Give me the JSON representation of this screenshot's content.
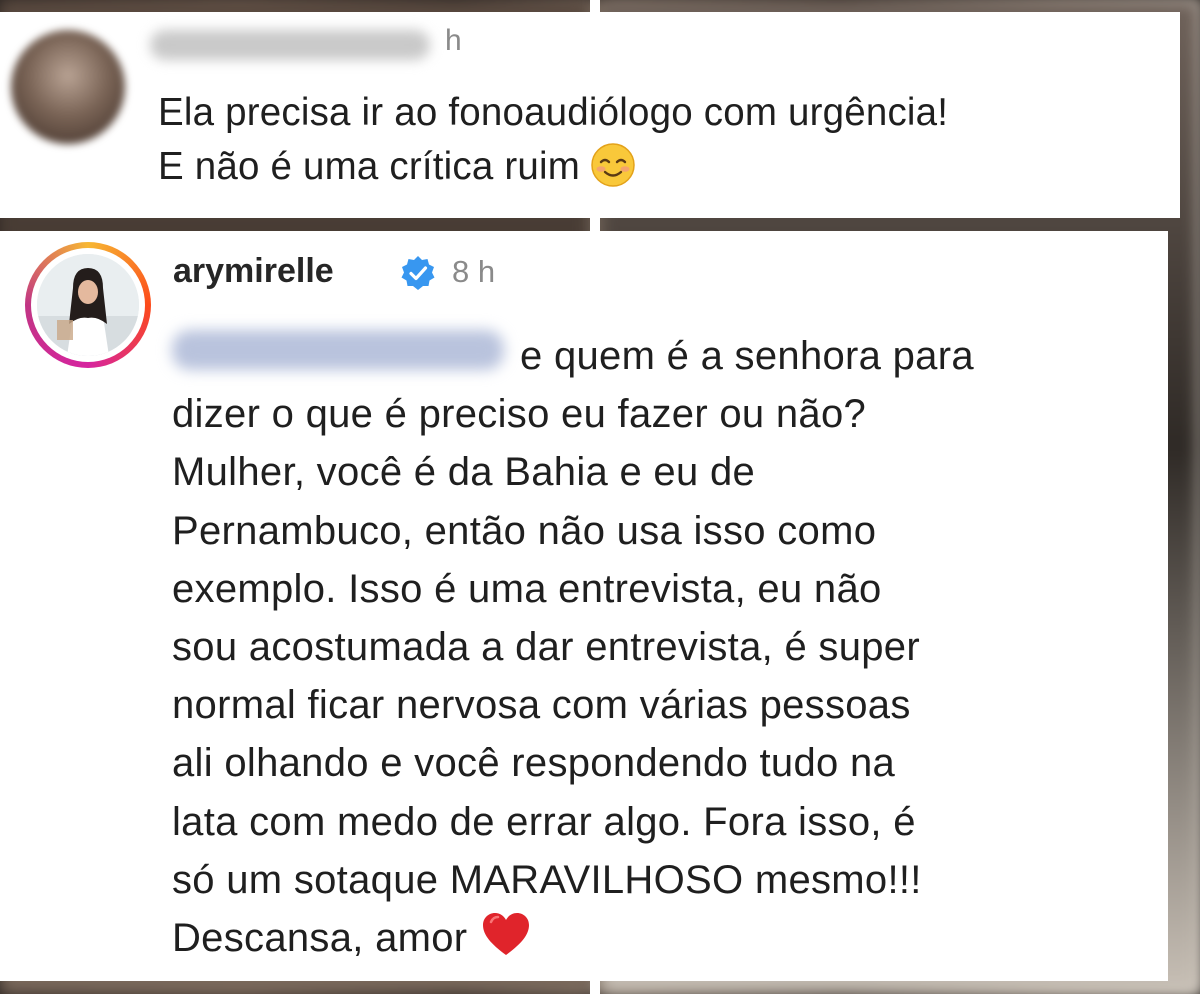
{
  "comment_1": {
    "time": "h",
    "lines": [
      "Ela precisa ir ao fonoaudiólogo com urgência!",
      "E não é uma crítica ruim"
    ],
    "emoji": "smiling-face-icon"
  },
  "comment_2": {
    "username": "arymirelle",
    "verified": true,
    "time": "8 h",
    "first_line_rest": "e quem é a senhora para",
    "lines": [
      "dizer o que é preciso eu fazer ou não?",
      "Mulher, você é da Bahia e eu de",
      "Pernambuco, então não usa isso como",
      "exemplo. Isso é uma entrevista, eu não",
      "sou acostumada a dar entrevista, é super",
      "normal ficar nervosa com várias pessoas",
      "ali olhando e você respondendo tudo na",
      "lata com medo de errar algo. Fora isso, é",
      "só um sotaque MARAVILHOSO mesmo!!!"
    ],
    "last_line": "Descansa, amor",
    "emoji": "red-heart-icon"
  },
  "colors": {
    "verified_blue": "#3897f0",
    "text": "#1f1f1f",
    "muted": "#8a8a8a",
    "heart_red": "#e0242b"
  }
}
